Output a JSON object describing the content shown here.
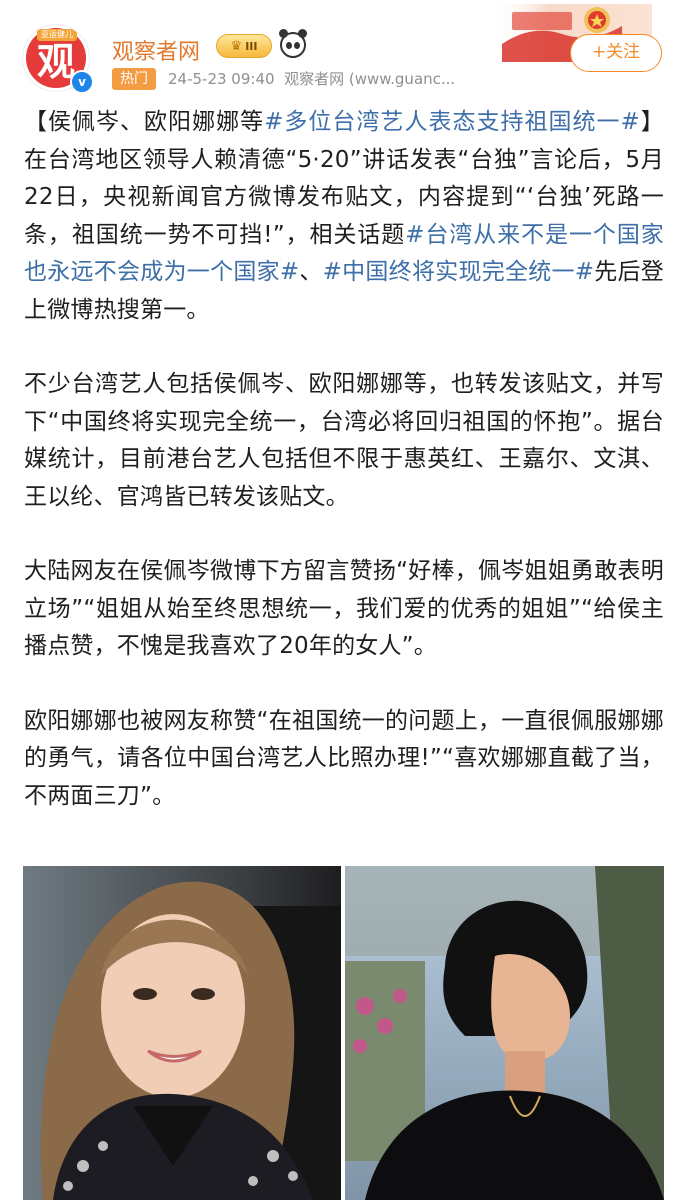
{
  "header": {
    "avatar_text": "观",
    "avatar_tag": "亚运健儿",
    "username": "观察者网",
    "level_badge": "III",
    "hot_label": "热门",
    "timestamp": "24-5-23 09:40",
    "source": "观察者网 (www.guanc...",
    "follow_label": "+关注"
  },
  "post": {
    "p1_a": "【侯佩岑、欧阳娜娜等",
    "p1_tag1": "#多位台湾艺人表态支持祖国统一#",
    "p1_b": "】在台湾地区领导人赖清德“5·20”讲话发表“台独”言论后，5月22日，央视新闻官方微博发布贴文，内容提到“‘台独’死路一条，祖国统一势不可挡!”，相关话题",
    "p1_tag2": "#台湾从来不是一个国家也永远不会成为一个国家#",
    "p1_c": "、",
    "p1_tag3": "#中国终将实现完全统一#",
    "p1_d": "先后登上微博热搜第一。",
    "p2": "不少台湾艺人包括侯佩岑、欧阳娜娜等，也转发该贴文，并写下“中国终将实现完全统一，台湾必将回归祖国的怀抱”。据台媒统计，目前港台艺人包括但不限于惠英红、王嘉尔、文淇、王以纶、官鸿皆已转发该贴文。",
    "p3": "大陆网友在侯佩岑微博下方留言赞扬“好棒，佩岑姐姐勇敢表明立场”“姐姐从始至终思想统一，我们爱的优秀的姐姐”“给侯主播点赞，不愧是我喜欢了20年的女人”。",
    "p4": "欧阳娜娜也被网友称赞“在祖国统一的问题上，一直很佩服娜娜的勇气，请各位中国台湾艺人比照办理!”“喜欢娜娜直截了当，不两面三刀”。"
  },
  "colors": {
    "username": "#e2792d",
    "hashtag": "#3e6fa8",
    "hot_badge": "#f39c41",
    "follow": "#f58a2c",
    "verified": "#1e86e8"
  },
  "icons": [
    "verified-icon",
    "crown-icon",
    "panda-icon"
  ]
}
